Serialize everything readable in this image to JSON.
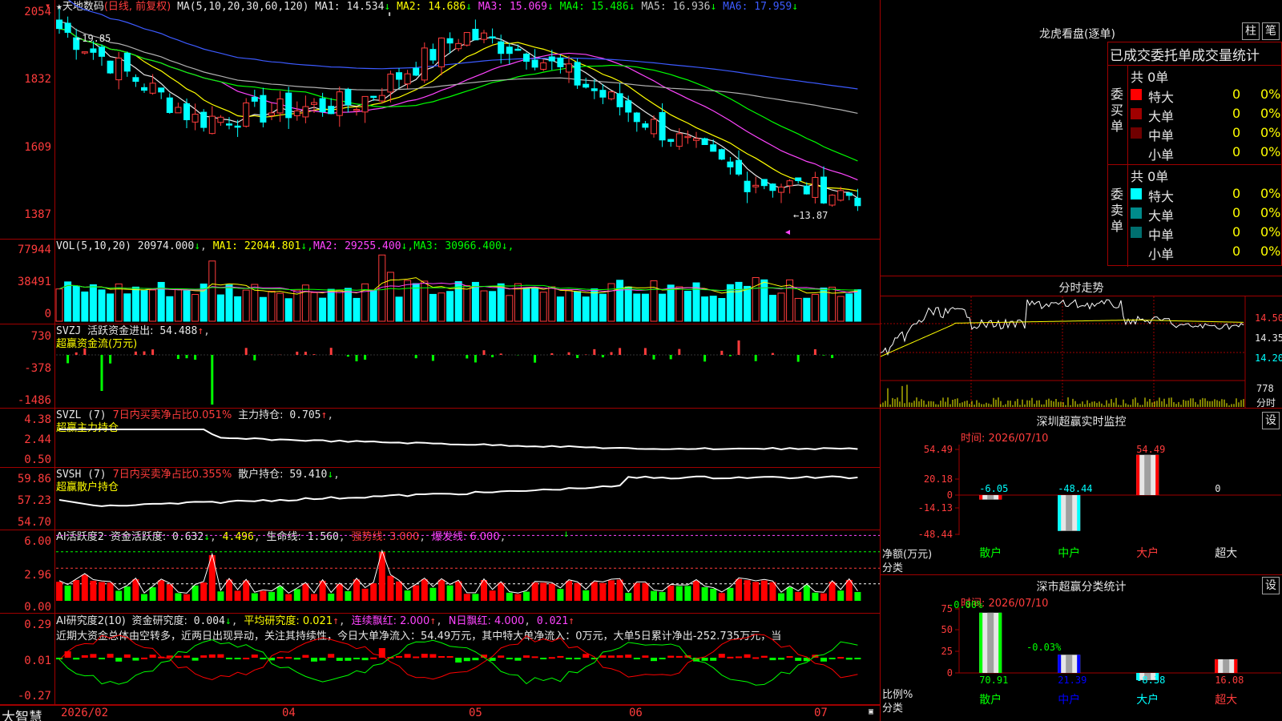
{
  "window": {
    "brand": "大智慧"
  },
  "kline": {
    "title_star": "★",
    "stock_name": "天地数码",
    "period": "(日线, 前复权)",
    "ma_header": "MA(5,10,20,30,60,120)",
    "ma": [
      {
        "label": "MA1:",
        "value": "14.534",
        "arrow": "↓",
        "color": "#e6e6e6"
      },
      {
        "label": "MA2:",
        "value": "14.686",
        "arrow": "↓",
        "color": "#ffff00"
      },
      {
        "label": "MA3:",
        "value": "15.069",
        "arrow": "↓",
        "color": "#ff44ff"
      },
      {
        "label": "MA4:",
        "value": "15.486",
        "arrow": "↓",
        "color": "#00ff00"
      },
      {
        "label": "MA5:",
        "value": "16.936",
        "arrow": "↓",
        "color": "#c0c0c0"
      },
      {
        "label": "MA6:",
        "value": "17.959",
        "arrow": "↓",
        "color": "#3c5aff"
      }
    ],
    "y_ticks": [
      "2054",
      "1832",
      "1609",
      "1387"
    ],
    "high_marker": "←19.85",
    "low_marker": "←13.87"
  },
  "volume": {
    "header": "VOL(5,10,20)",
    "value": "20974.000",
    "ma": [
      {
        "label": "MA1:",
        "value": "22044.801",
        "arrow": "↓",
        "color": "#ffff00"
      },
      {
        "label": "MA2:",
        "value": "29255.400",
        "arrow": "↓",
        "color": "#ff44ff"
      },
      {
        "label": "MA3:",
        "value": "30966.400",
        "arrow": "↓",
        "color": "#00ff00"
      }
    ],
    "y_ticks": [
      "77944",
      "38491",
      "0"
    ]
  },
  "svzj": {
    "header": "SVZJ",
    "label": "活跃资金进出:",
    "value": "54.488",
    "arrow": "↑",
    "subtitle": "超赢资金流(万元)",
    "y_ticks": [
      "730",
      "-378",
      "-1486"
    ]
  },
  "svzl": {
    "header": "SVZL (7)",
    "ratio": "7日内买卖净占比0.051%",
    "label": "主力持仓:",
    "value": "0.705",
    "arrow": "↑",
    "subtitle": "超赢主力持仓",
    "y_ticks": [
      "4.38",
      "2.44",
      "0.50"
    ]
  },
  "svsh": {
    "header": "SVSH (7)",
    "ratio": "7日内买卖净占比0.355%",
    "label": "散户持仓:",
    "value": "59.410",
    "arrow": "↓",
    "subtitle": "超赢散户持仓",
    "y_ticks": [
      "59.86",
      "57.23",
      "54.70"
    ]
  },
  "ai_activity": {
    "header": "AI活跃度2",
    "label": "资金活跃度:",
    "value": "0.632",
    "arrow": "↓",
    "v2": "4.496",
    "life_label": "生命线:",
    "life": "1.560",
    "strong": "强势线: 3.000",
    "burst": "爆发线: 6.000",
    "y_ticks": [
      "6.00",
      "2.96",
      "0.00"
    ]
  },
  "ai_research": {
    "header": "AI研究度2(10)",
    "label": "资金研究度:",
    "value": "0.004",
    "arrow": "↓",
    "avg": "平均研究度: 0.021",
    "consecutive": "连续飘红: 2.000",
    "n_days": "N日飘红: 4.000",
    "last": "0.021",
    "comment": "近期大资金总体由空转多，近两日出现异动，关注其持续性，今日大单净流入：54.49万元，其中特大单净流入：0万元，大单5日累计净出-252.735万元，当",
    "y_ticks": [
      "0.29",
      "0.01",
      "-0.27"
    ]
  },
  "xaxis": {
    "labels": [
      "2026/02",
      "04",
      "05",
      "06",
      "07"
    ]
  },
  "dragon": {
    "title": "龙虎看盘(逐单)",
    "tabs": [
      "柱",
      "笔"
    ],
    "table_title": "已成交委托单成交量统计",
    "buy": {
      "side": "委买单",
      "total": "共 0单",
      "rows": [
        {
          "label": "特大",
          "count": "0",
          "pct": "0%",
          "color": "#ff0000"
        },
        {
          "label": "大单",
          "count": "0",
          "pct": "0%",
          "color": "#a00000"
        },
        {
          "label": "中单",
          "count": "0",
          "pct": "0%",
          "color": "#700000"
        },
        {
          "label": "小单",
          "count": "0",
          "pct": "0%",
          "color": ""
        }
      ]
    },
    "sell": {
      "side": "委卖单",
      "total": "共 0单",
      "rows": [
        {
          "label": "特大",
          "count": "0",
          "pct": "0%",
          "color": "#00ffff"
        },
        {
          "label": "大单",
          "count": "0",
          "pct": "0%",
          "color": "#008b8b"
        },
        {
          "label": "中单",
          "count": "0",
          "pct": "0%",
          "color": "#006f6f"
        },
        {
          "label": "小单",
          "count": "0",
          "pct": "0%",
          "color": ""
        }
      ]
    }
  },
  "intraday": {
    "title": "分时走势",
    "price_ticks": [
      "14.50",
      "14.35",
      "14.20"
    ],
    "vol_tick": "778",
    "unit": "分时"
  },
  "monitor": {
    "title": "深圳超赢实时监控",
    "settings": "设",
    "time": "时间: 2026/07/10",
    "y_label": "净额(万元)",
    "x_label": "分类",
    "y_ticks": [
      "54.49",
      "20.18",
      "0",
      "-14.13",
      "-48.44"
    ],
    "categories": [
      "散户",
      "中户",
      "大户",
      "超大"
    ],
    "values": [
      -6.05,
      -48.44,
      54.49,
      0
    ],
    "value_labels": [
      "-6.05",
      "-48.44",
      "54.49",
      "0"
    ]
  },
  "stats": {
    "title": "深市超赢分类统计",
    "settings": "设",
    "time": "时间: 2026/07/10",
    "y_label": "比例%",
    "x_label": "分类",
    "y_ticks": [
      "75",
      "50",
      "25",
      "0"
    ],
    "categories": [
      "散户",
      "中户",
      "大户",
      "超大"
    ],
    "values": [
      70.91,
      21.39,
      -8.38,
      16.08
    ],
    "value_labels": [
      "70.91",
      "21.39",
      "-8.38",
      "16.08"
    ],
    "top_labels": [
      "-0.00%",
      "-0.03%"
    ]
  },
  "chart_data": [
    {
      "type": "bar",
      "title": "深圳超赢实时监控",
      "ylabel": "净额(万元)",
      "xlabel": "分类",
      "categories": [
        "散户",
        "中户",
        "大户",
        "超大"
      ],
      "values": [
        -6.05,
        -48.44,
        54.49,
        0
      ],
      "ylim": [
        -48.44,
        54.49
      ]
    },
    {
      "type": "bar",
      "title": "深市超赢分类统计",
      "ylabel": "比例%",
      "xlabel": "分类",
      "categories": [
        "散户",
        "中户",
        "大户",
        "超大"
      ],
      "values": [
        70.91,
        21.39,
        -8.38,
        16.08
      ],
      "ylim": [
        0,
        75
      ]
    }
  ]
}
